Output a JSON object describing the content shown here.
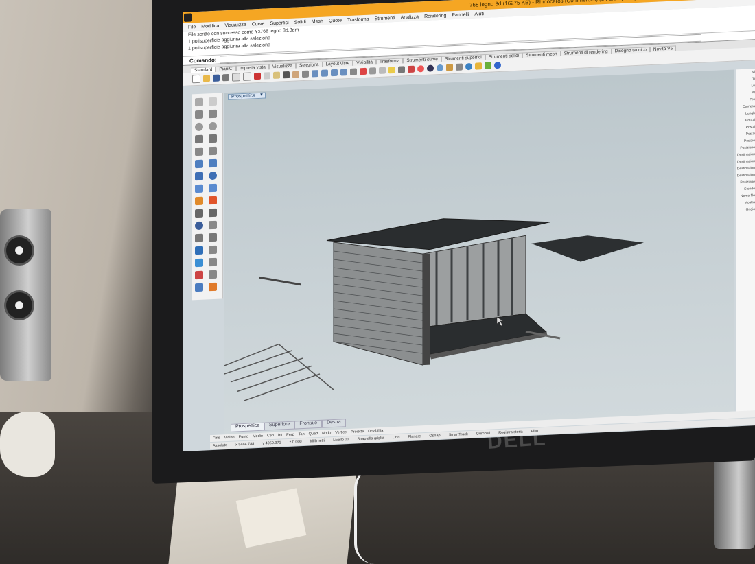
{
  "window": {
    "title": "768 legno 3d (16275 KB) - Rhinoceros (Commercial) (64-bit) - [Prospettica]"
  },
  "menu": [
    "File",
    "Modifica",
    "Visualizza",
    "Curve",
    "Superfici",
    "Solidi",
    "Mesh",
    "Quote",
    "Trasforma",
    "Strumenti",
    "Analizza",
    "Rendering",
    "Pannelli",
    "Aiuti"
  ],
  "history": [
    "File scritto con successo come Y:\\768 legno 3d.3dm",
    "1 polisuperficie aggiunta alla selezione",
    "1 polisuperficie aggiunta alla selezione"
  ],
  "command": {
    "label": "Comando:"
  },
  "toolbar_tabs": [
    "Standard",
    "PianiC",
    "Imposta vista",
    "Visualizza",
    "Seleziona",
    "Layout viste",
    "Visibilità",
    "Trasforma",
    "Strumenti curve",
    "Strumenti superfici",
    "Strumenti solidi",
    "Strumenti mesh",
    "Strumenti di rendering",
    "Disegno tecnico",
    "Novità V5"
  ],
  "viewport": {
    "label": "Prospettica"
  },
  "view_tabs": [
    "Prospettica",
    "Superiore",
    "Frontale",
    "Destra"
  ],
  "properties": [
    "Vi",
    "Ti",
    "Lu",
    "Al",
    "Pro",
    "Camera",
    "Lungh",
    "Rotazi",
    "Posizi",
    "Posizi",
    "Posizio",
    "Posizione",
    "Destinazion",
    "Destinazion",
    "Destinazion",
    "Destinazion",
    "Posizione",
    "Sfondo",
    "Nome file",
    "Mostra",
    "Grigio"
  ],
  "osnaps": [
    "Fine",
    "Vicino",
    "Punto",
    "Medio",
    "Cen",
    "Int",
    "Perp",
    "Tan",
    "Quad",
    "Nodo",
    "Vertice",
    "Proietta",
    "Disabilita"
  ],
  "statusbar": [
    "Assoluto",
    "x 5484.788",
    "y 4050.371",
    "z 0.000",
    "Millimetri",
    "Livello 01",
    "Snap alla griglia",
    "Orto",
    "Planare",
    "Osnap",
    "SmartTrack",
    "Gumball",
    "Registra storia",
    "Filtro"
  ],
  "colors": {
    "titlebar": "#f5a623",
    "taskbar": "#f0a22e",
    "viewport_bg": "#c2ccd1",
    "model_dark": "#2a2d2f"
  }
}
